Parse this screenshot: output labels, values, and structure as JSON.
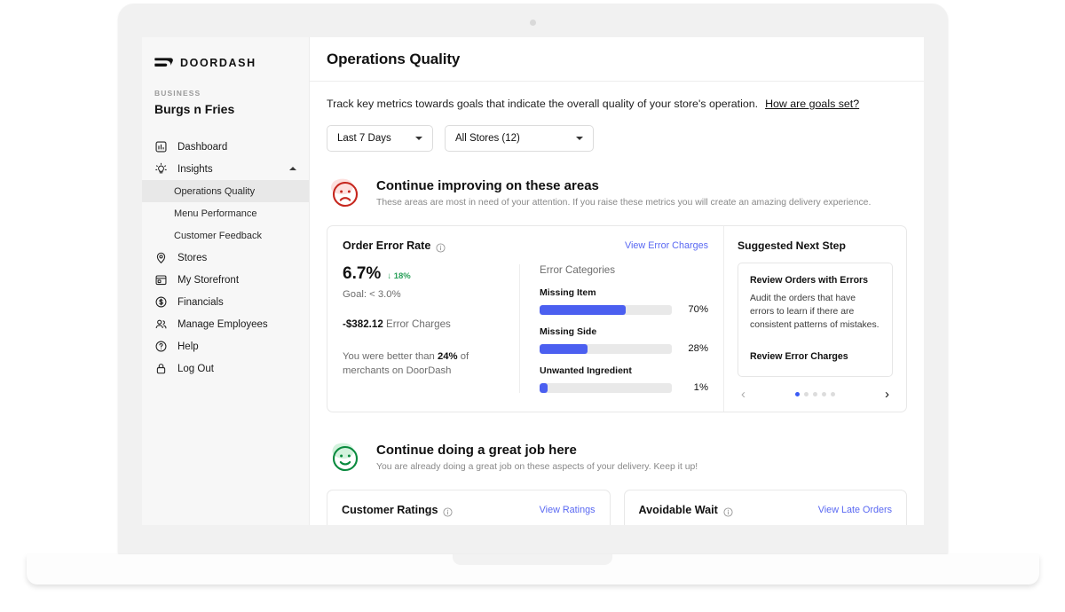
{
  "brand": {
    "name": "DOORDASH",
    "logo_icon": "doordash-logo-icon"
  },
  "sidebar": {
    "business_label": "BUSINESS",
    "business_name": "Burgs n Fries",
    "items": [
      {
        "label": "Dashboard",
        "icon": "bar-chart-icon"
      },
      {
        "label": "Insights",
        "icon": "lightbulb-icon",
        "expanded": true
      },
      {
        "label": "Stores",
        "icon": "map-pin-icon"
      },
      {
        "label": "My Storefront",
        "icon": "storefront-icon"
      },
      {
        "label": "Financials",
        "icon": "dollar-circle-icon"
      },
      {
        "label": "Manage Employees",
        "icon": "people-icon"
      },
      {
        "label": "Help",
        "icon": "question-circle-icon"
      },
      {
        "label": "Log Out",
        "icon": "lock-icon"
      }
    ],
    "sub_items": [
      {
        "label": "Operations Quality",
        "active": true
      },
      {
        "label": "Menu Performance",
        "active": false
      },
      {
        "label": "Customer Feedback",
        "active": false
      }
    ]
  },
  "header": {
    "title": "Operations Quality"
  },
  "intro": {
    "text": "Track key metrics towards goals that indicate the overall quality of your store's operation.",
    "link": "How are goals set?"
  },
  "filters": {
    "date_range": {
      "value": "Last 7 Days",
      "icon": "chevron-down-icon"
    },
    "stores": {
      "value": "All Stores (12)",
      "icon": "chevron-down-icon"
    }
  },
  "improve_banner": {
    "icon": "sad-face-icon",
    "title": "Continue improving on these areas",
    "subtitle": "These areas are most in need of your attention. If you raise these metrics you will create an amazing delivery experience."
  },
  "error_card": {
    "title": "Order Error Rate",
    "info_icon": "info-icon",
    "link": "View Error Charges",
    "value": "6.7%",
    "delta": "↓ 18%",
    "delta_color": "#2aa05a",
    "goal": "Goal: < 3.0%",
    "charges_amount": "-$382.12",
    "charges_label": "Error Charges",
    "benchmark_pre": "You were better than ",
    "benchmark_pct": "24%",
    "benchmark_post": " of merchants on DoorDash",
    "categories_title": "Error Categories",
    "bar_color": "#4b5ff0"
  },
  "chart_data": {
    "type": "bar",
    "title": "Error Categories",
    "categories": [
      "Missing Item",
      "Missing Side",
      "Unwanted Ingredient"
    ],
    "values": [
      70,
      28,
      1
    ],
    "value_labels": [
      "70%",
      "28%",
      "1%"
    ],
    "bar_widths_pct": [
      65,
      36,
      6
    ],
    "xlabel": "",
    "ylabel": "",
    "xlim": [
      0,
      100
    ],
    "orientation": "horizontal",
    "grid": false,
    "legend": false
  },
  "suggested": {
    "title": "Suggested Next Step",
    "card_title": "Review Orders with Errors",
    "card_body": "Audit the orders that have errors to learn if there are consistent patterns of mistakes.",
    "cta": "Review Error Charges",
    "prev_icon": "chevron-left-icon",
    "next_icon": "chevron-right-icon",
    "dots_total": 5,
    "dots_active_index": 0,
    "active_dot_color": "#3b5bf5"
  },
  "great_banner": {
    "icon": "happy-face-icon",
    "title": "Continue doing a great job here",
    "subtitle": "You are already doing a great job on these aspects of your delivery. Keep it up!"
  },
  "bottom_cards": [
    {
      "title": "Customer Ratings",
      "info_icon": "info-icon",
      "link": "View Ratings"
    },
    {
      "title": "Avoidable Wait",
      "info_icon": "info-icon",
      "link": "View Late Orders"
    }
  ]
}
